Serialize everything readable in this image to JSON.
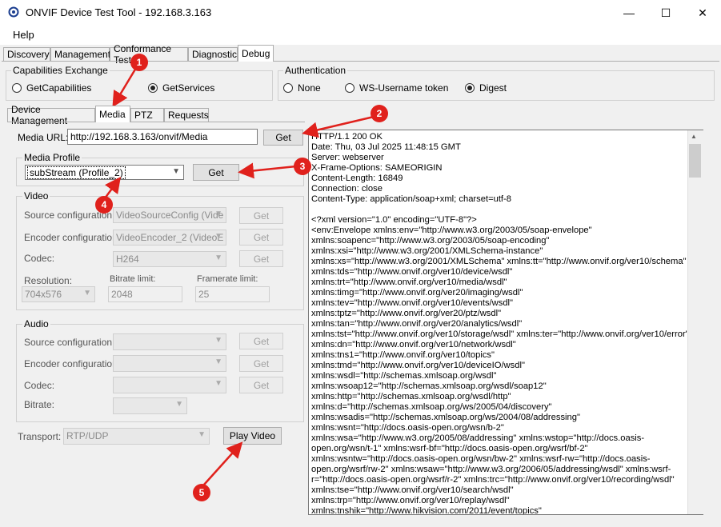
{
  "window": {
    "title": "ONVIF Device Test Tool - 192.168.3.163",
    "minimize": "—",
    "maximize": "☐",
    "close": "✕"
  },
  "menu": {
    "help": "Help"
  },
  "main_tabs": [
    "Discovery",
    "Management",
    "Conformance Test",
    "Diagnostic",
    "Debug"
  ],
  "capabilities": {
    "title": "Capabilities Exchange",
    "options": [
      "GetCapabilities",
      "GetServices"
    ],
    "selected": "GetServices"
  },
  "authentication": {
    "title": "Authentication",
    "options": [
      "None",
      "WS-Username token",
      "Digest"
    ],
    "selected": "Digest"
  },
  "sub_tabs": [
    "Device Management",
    "Media",
    "PTZ",
    "Requests"
  ],
  "media_url": {
    "label": "Media URL:",
    "value": "http://192.168.3.163/onvif/Media",
    "button": "Get"
  },
  "media_profile": {
    "title": "Media Profile",
    "value": "subStream (Profile_2)",
    "button": "Get"
  },
  "video": {
    "title": "Video",
    "source_label": "Source configuration:",
    "source_value": "VideoSourceConfig (Vide",
    "encoder_label": "Encoder configuration:",
    "encoder_value": "VideoEncoder_2 (VideoE",
    "codec_label": "Codec:",
    "codec_value": "H264",
    "resolution_label": "Resolution:",
    "resolution_value": "704x576",
    "bitrate_label": "Bitrate limit:",
    "bitrate_value": "2048",
    "framerate_label": "Framerate limit:",
    "framerate_value": "25",
    "get": "Get"
  },
  "audio": {
    "title": "Audio",
    "source_label": "Source configuration:",
    "encoder_label": "Encoder configuration:",
    "codec_label": "Codec:",
    "bitrate_label": "Bitrate:",
    "get": "Get"
  },
  "transport": {
    "label": "Transport:",
    "value": "RTP/UDP",
    "play": "Play Video"
  },
  "response_text": "HTTP/1.1 200 OK\nDate: Thu, 03 Jul 2025 11:48:15 GMT\nServer: webserver\nX-Frame-Options: SAMEORIGIN\nContent-Length: 16849\nConnection: close\nContent-Type: application/soap+xml; charset=utf-8\n\n<?xml version=\"1.0\" encoding=\"UTF-8\"?>\n<env:Envelope xmlns:env=\"http://www.w3.org/2003/05/soap-envelope\"\nxmlns:soapenc=\"http://www.w3.org/2003/05/soap-encoding\"\nxmlns:xsi=\"http://www.w3.org/2001/XMLSchema-instance\"\nxmlns:xs=\"http://www.w3.org/2001/XMLSchema\" xmlns:tt=\"http://www.onvif.org/ver10/schema\"\nxmlns:tds=\"http://www.onvif.org/ver10/device/wsdl\"\nxmlns:trt=\"http://www.onvif.org/ver10/media/wsdl\"\nxmlns:timg=\"http://www.onvif.org/ver20/imaging/wsdl\"\nxmlns:tev=\"http://www.onvif.org/ver10/events/wsdl\"\nxmlns:tptz=\"http://www.onvif.org/ver20/ptz/wsdl\"\nxmlns:tan=\"http://www.onvif.org/ver20/analytics/wsdl\"\nxmlns:tst=\"http://www.onvif.org/ver10/storage/wsdl\" xmlns:ter=\"http://www.onvif.org/ver10/error\"\nxmlns:dn=\"http://www.onvif.org/ver10/network/wsdl\"\nxmlns:tns1=\"http://www.onvif.org/ver10/topics\"\nxmlns:tmd=\"http://www.onvif.org/ver10/deviceIO/wsdl\"\nxmlns:wsdl=\"http://schemas.xmlsoap.org/wsdl\"\nxmlns:wsoap12=\"http://schemas.xmlsoap.org/wsdl/soap12\"\nxmlns:http=\"http://schemas.xmlsoap.org/wsdl/http\"\nxmlns:d=\"http://schemas.xmlsoap.org/ws/2005/04/discovery\"\nxmlns:wsadis=\"http://schemas.xmlsoap.org/ws/2004/08/addressing\"\nxmlns:wsnt=\"http://docs.oasis-open.org/wsn/b-2\"\nxmlns:wsa=\"http://www.w3.org/2005/08/addressing\" xmlns:wstop=\"http://docs.oasis-\nopen.org/wsn/t-1\" xmlns:wsrf-bf=\"http://docs.oasis-open.org/wsrf/bf-2\"\nxmlns:wsntw=\"http://docs.oasis-open.org/wsn/bw-2\" xmlns:wsrf-rw=\"http://docs.oasis-\nopen.org/wsrf/rw-2\" xmlns:wsaw=\"http://www.w3.org/2006/05/addressing/wsdl\" xmlns:wsrf-\nr=\"http://docs.oasis-open.org/wsrf/r-2\" xmlns:trc=\"http://www.onvif.org/ver10/recording/wsdl\"\nxmlns:tse=\"http://www.onvif.org/ver10/search/wsdl\"\nxmlns:trp=\"http://www.onvif.org/ver10/replay/wsdl\"\nxmlns:tnshik=\"http://www.hikvision.com/2011/event/topics\"",
  "annotations": [
    "1",
    "2",
    "3",
    "4",
    "5"
  ],
  "colors": {
    "annotation": "#e0211c",
    "window_bg": "#f0f0f0"
  }
}
